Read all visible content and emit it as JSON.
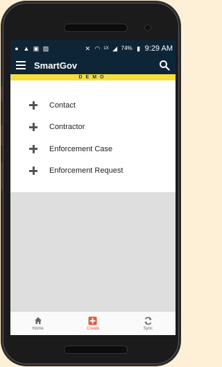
{
  "statusbar": {
    "battery": "74%",
    "time": "9:29 AM",
    "network": "1X"
  },
  "appbar": {
    "title": "SmartGov"
  },
  "banner": {
    "text": "DEMO"
  },
  "create_items": [
    {
      "label": "Contact"
    },
    {
      "label": "Contractor"
    },
    {
      "label": "Enforcement Case"
    },
    {
      "label": "Enforcement Request"
    }
  ],
  "bottom_nav": {
    "tabs": [
      {
        "label": "Home",
        "icon": "home-icon"
      },
      {
        "label": "Create",
        "icon": "plus-square-icon"
      },
      {
        "label": "Sync",
        "icon": "sync-icon"
      }
    ],
    "active": "Create"
  },
  "colors": {
    "appbar": "#0e2538",
    "banner": "#f4dc3a",
    "active_tab": "#e8553a"
  }
}
